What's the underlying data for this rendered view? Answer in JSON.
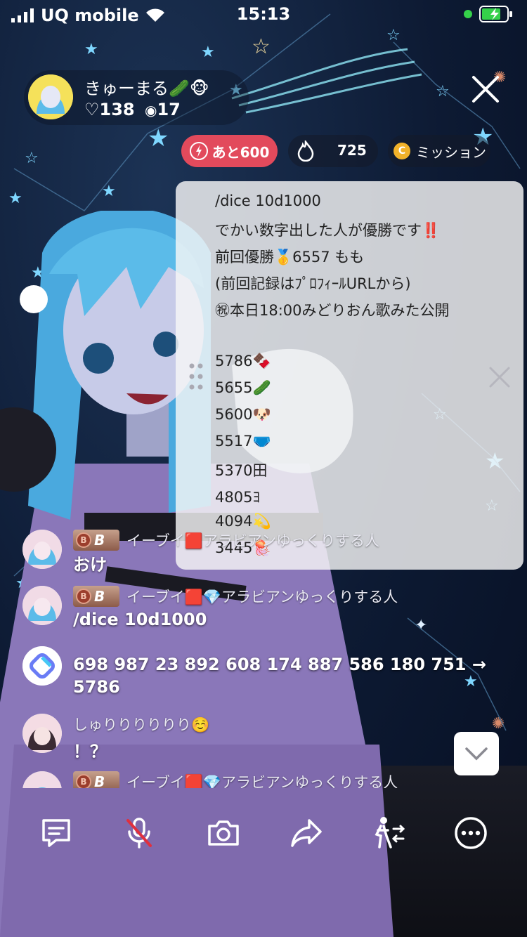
{
  "status_bar": {
    "carrier": "UQ mobile",
    "time": "15:13"
  },
  "host": {
    "name": "きゅーまる🥒🐵",
    "likes": "♡138",
    "viewers": "17"
  },
  "pills": {
    "boost": "あと600",
    "points": "725",
    "mission": "ミッション",
    "mission_coin": "C"
  },
  "note": {
    "lines": [
      "/dice 10d1000",
      "でかい数字出した人が優勝です‼️",
      "前回優勝🥇6557 もも",
      "(前回記録はﾌﾟﾛﾌｨｰﾙURLから)",
      "㊗本日18:00みどりおん歌みた公開",
      "5786🍫",
      "5655🥒",
      "5600🐶",
      "5517🩲",
      "5370田",
      "4805ﾖ",
      "4094💫",
      "3445🪼"
    ]
  },
  "comments": [
    {
      "name": "イーブイ🟥アラビアンゆっくりする人",
      "text": "おけ"
    },
    {
      "name": "イーブイ🟥💎アラビアンゆっくりする人",
      "text": "/dice 10d1000"
    },
    {
      "name": "",
      "text": "698 987 23 892 608 174 887 586 180 751 →",
      "text2": "5786"
    },
    {
      "name": "しゅりりりりりり☺️",
      "text": "！？"
    },
    {
      "name": "イーブイ🟥💎アラビアンゆっくりする人",
      "text": ""
    }
  ],
  "badge": {
    "level": "B",
    "coin": "B"
  },
  "colors": {
    "boost_red": "#e24a5c",
    "coin_gold": "#f1b22a",
    "star_cyan": "#7fd7ff"
  },
  "toolbar_icons": [
    "comment-icon",
    "mic-off-icon",
    "camera-icon",
    "share-icon",
    "collab-icon",
    "more-icon"
  ]
}
